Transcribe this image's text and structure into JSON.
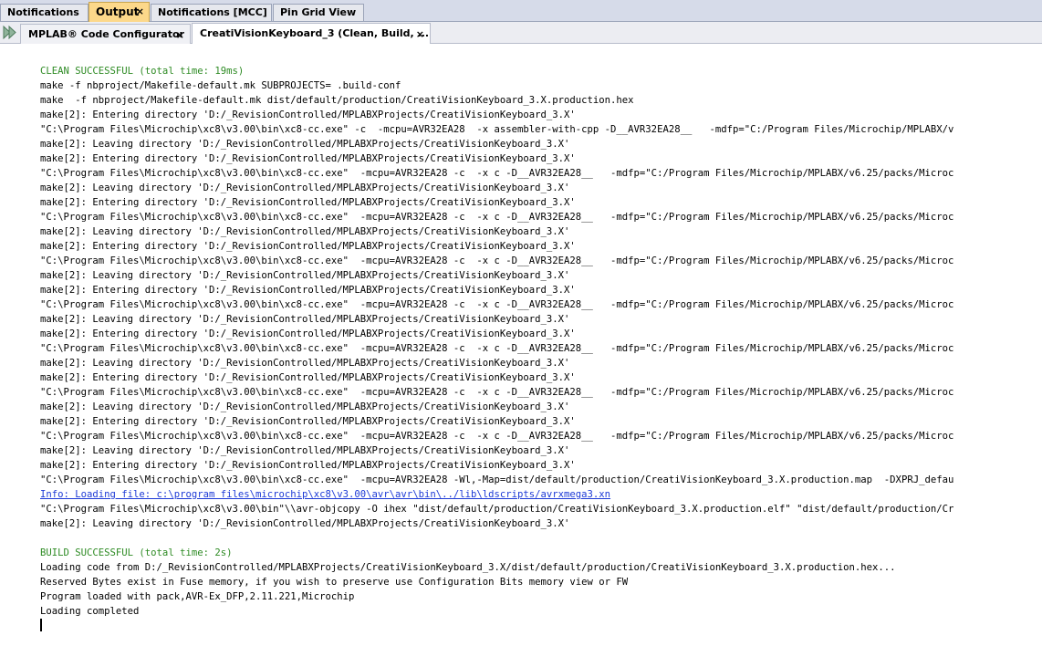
{
  "top_tabs": [
    {
      "label": "Notifications",
      "active": false,
      "closable": false
    },
    {
      "label": "Output",
      "active": true,
      "closable": true
    },
    {
      "label": "Notifications [MCC]",
      "active": false,
      "closable": false
    },
    {
      "label": "Pin Grid View",
      "active": false,
      "closable": false
    }
  ],
  "sub_tabs": [
    {
      "label": "MPLAB® Code Configurator",
      "active": false,
      "closable": true
    },
    {
      "label": "CreatiVisionKeyboard_3 (Clean, Build, ...)",
      "active": true,
      "closable": true
    }
  ],
  "close_glyph": "×",
  "colors": {
    "success": "#2e8b24",
    "link": "#1d3ad6",
    "active_tab": "#fcd88a"
  },
  "output_lines": [
    {
      "text": "CLEAN SUCCESSFUL (total time: 19ms)",
      "kind": "success"
    },
    {
      "text": "make -f nbproject/Makefile-default.mk SUBPROJECTS= .build-conf",
      "kind": "normal"
    },
    {
      "text": "make  -f nbproject/Makefile-default.mk dist/default/production/CreatiVisionKeyboard_3.X.production.hex",
      "kind": "normal"
    },
    {
      "text": "make[2]: Entering directory 'D:/_RevisionControlled/MPLABXProjects/CreatiVisionKeyboard_3.X'",
      "kind": "normal"
    },
    {
      "text": "\"C:\\Program Files\\Microchip\\xc8\\v3.00\\bin\\xc8-cc.exe\" -c  -mcpu=AVR32EA28  -x assembler-with-cpp -D__AVR32EA28__   -mdfp=\"C:/Program Files/Microchip/MPLABX/v",
      "kind": "normal"
    },
    {
      "text": "make[2]: Leaving directory 'D:/_RevisionControlled/MPLABXProjects/CreatiVisionKeyboard_3.X'",
      "kind": "normal"
    },
    {
      "text": "make[2]: Entering directory 'D:/_RevisionControlled/MPLABXProjects/CreatiVisionKeyboard_3.X'",
      "kind": "normal"
    },
    {
      "text": "\"C:\\Program Files\\Microchip\\xc8\\v3.00\\bin\\xc8-cc.exe\"  -mcpu=AVR32EA28 -c  -x c -D__AVR32EA28__   -mdfp=\"C:/Program Files/Microchip/MPLABX/v6.25/packs/Microc",
      "kind": "normal"
    },
    {
      "text": "make[2]: Leaving directory 'D:/_RevisionControlled/MPLABXProjects/CreatiVisionKeyboard_3.X'",
      "kind": "normal"
    },
    {
      "text": "make[2]: Entering directory 'D:/_RevisionControlled/MPLABXProjects/CreatiVisionKeyboard_3.X'",
      "kind": "normal"
    },
    {
      "text": "\"C:\\Program Files\\Microchip\\xc8\\v3.00\\bin\\xc8-cc.exe\"  -mcpu=AVR32EA28 -c  -x c -D__AVR32EA28__   -mdfp=\"C:/Program Files/Microchip/MPLABX/v6.25/packs/Microc",
      "kind": "normal"
    },
    {
      "text": "make[2]: Leaving directory 'D:/_RevisionControlled/MPLABXProjects/CreatiVisionKeyboard_3.X'",
      "kind": "normal"
    },
    {
      "text": "make[2]: Entering directory 'D:/_RevisionControlled/MPLABXProjects/CreatiVisionKeyboard_3.X'",
      "kind": "normal"
    },
    {
      "text": "\"C:\\Program Files\\Microchip\\xc8\\v3.00\\bin\\xc8-cc.exe\"  -mcpu=AVR32EA28 -c  -x c -D__AVR32EA28__   -mdfp=\"C:/Program Files/Microchip/MPLABX/v6.25/packs/Microc",
      "kind": "normal"
    },
    {
      "text": "make[2]: Leaving directory 'D:/_RevisionControlled/MPLABXProjects/CreatiVisionKeyboard_3.X'",
      "kind": "normal"
    },
    {
      "text": "make[2]: Entering directory 'D:/_RevisionControlled/MPLABXProjects/CreatiVisionKeyboard_3.X'",
      "kind": "normal"
    },
    {
      "text": "\"C:\\Program Files\\Microchip\\xc8\\v3.00\\bin\\xc8-cc.exe\"  -mcpu=AVR32EA28 -c  -x c -D__AVR32EA28__   -mdfp=\"C:/Program Files/Microchip/MPLABX/v6.25/packs/Microc",
      "kind": "normal"
    },
    {
      "text": "make[2]: Leaving directory 'D:/_RevisionControlled/MPLABXProjects/CreatiVisionKeyboard_3.X'",
      "kind": "normal"
    },
    {
      "text": "make[2]: Entering directory 'D:/_RevisionControlled/MPLABXProjects/CreatiVisionKeyboard_3.X'",
      "kind": "normal"
    },
    {
      "text": "\"C:\\Program Files\\Microchip\\xc8\\v3.00\\bin\\xc8-cc.exe\"  -mcpu=AVR32EA28 -c  -x c -D__AVR32EA28__   -mdfp=\"C:/Program Files/Microchip/MPLABX/v6.25/packs/Microc",
      "kind": "normal"
    },
    {
      "text": "make[2]: Leaving directory 'D:/_RevisionControlled/MPLABXProjects/CreatiVisionKeyboard_3.X'",
      "kind": "normal"
    },
    {
      "text": "make[2]: Entering directory 'D:/_RevisionControlled/MPLABXProjects/CreatiVisionKeyboard_3.X'",
      "kind": "normal"
    },
    {
      "text": "\"C:\\Program Files\\Microchip\\xc8\\v3.00\\bin\\xc8-cc.exe\"  -mcpu=AVR32EA28 -c  -x c -D__AVR32EA28__   -mdfp=\"C:/Program Files/Microchip/MPLABX/v6.25/packs/Microc",
      "kind": "normal"
    },
    {
      "text": "make[2]: Leaving directory 'D:/_RevisionControlled/MPLABXProjects/CreatiVisionKeyboard_3.X'",
      "kind": "normal"
    },
    {
      "text": "make[2]: Entering directory 'D:/_RevisionControlled/MPLABXProjects/CreatiVisionKeyboard_3.X'",
      "kind": "normal"
    },
    {
      "text": "\"C:\\Program Files\\Microchip\\xc8\\v3.00\\bin\\xc8-cc.exe\"  -mcpu=AVR32EA28 -c  -x c -D__AVR32EA28__   -mdfp=\"C:/Program Files/Microchip/MPLABX/v6.25/packs/Microc",
      "kind": "normal"
    },
    {
      "text": "make[2]: Leaving directory 'D:/_RevisionControlled/MPLABXProjects/CreatiVisionKeyboard_3.X'",
      "kind": "normal"
    },
    {
      "text": "make[2]: Entering directory 'D:/_RevisionControlled/MPLABXProjects/CreatiVisionKeyboard_3.X'",
      "kind": "normal"
    },
    {
      "text": "\"C:\\Program Files\\Microchip\\xc8\\v3.00\\bin\\xc8-cc.exe\"  -mcpu=AVR32EA28 -Wl,-Map=dist/default/production/CreatiVisionKeyboard_3.X.production.map  -DXPRJ_defau",
      "kind": "normal"
    },
    {
      "text": "Info: Loading file: c:\\program files\\microchip\\xc8\\v3.00\\avr\\avr\\bin\\../lib\\ldscripts/avrxmega3.xn",
      "kind": "link"
    },
    {
      "text": "\"C:\\Program Files\\Microchip\\xc8\\v3.00\\bin\"\\\\avr-objcopy -O ihex \"dist/default/production/CreatiVisionKeyboard_3.X.production.elf\" \"dist/default/production/Cr",
      "kind": "normal"
    },
    {
      "text": "make[2]: Leaving directory 'D:/_RevisionControlled/MPLABXProjects/CreatiVisionKeyboard_3.X'",
      "kind": "normal"
    },
    {
      "text": "",
      "kind": "normal"
    },
    {
      "text": "BUILD SUCCESSFUL (total time: 2s)",
      "kind": "success"
    },
    {
      "text": "Loading code from D:/_RevisionControlled/MPLABXProjects/CreatiVisionKeyboard_3.X/dist/default/production/CreatiVisionKeyboard_3.X.production.hex...",
      "kind": "normal"
    },
    {
      "text": "Reserved Bytes exist in Fuse memory, if you wish to preserve use Configuration Bits memory view or FW",
      "kind": "normal"
    },
    {
      "text": "Program loaded with pack,AVR-Ex_DFP,2.11.221,Microchip",
      "kind": "normal"
    },
    {
      "text": "Loading completed",
      "kind": "normal"
    }
  ]
}
